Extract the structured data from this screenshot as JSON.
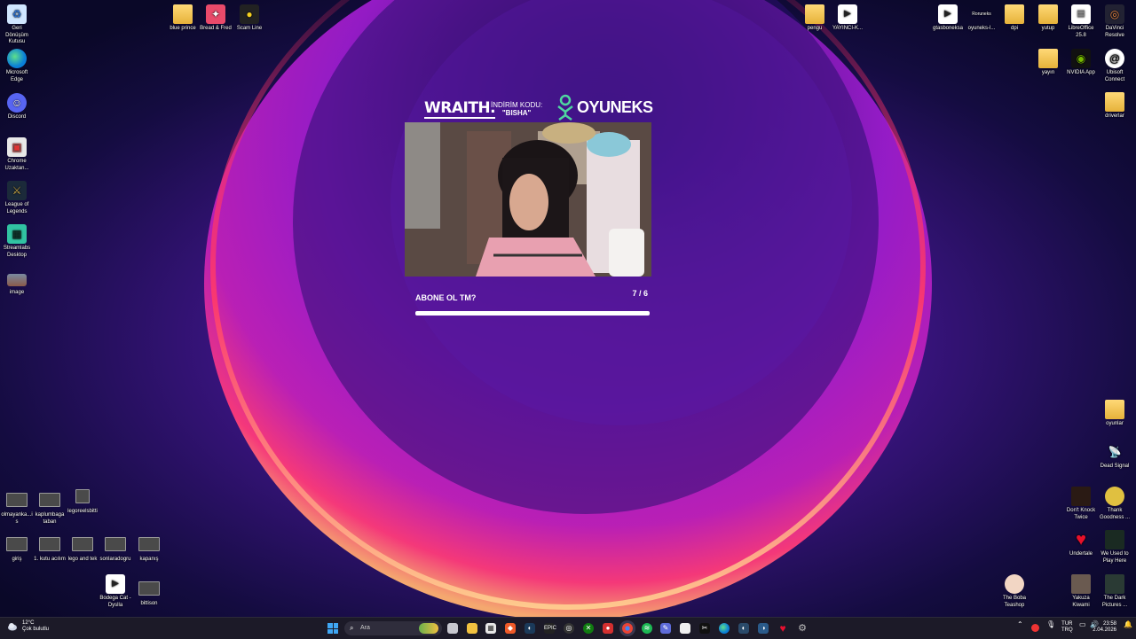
{
  "desktop": {
    "icons_left": [
      {
        "label": "Geri Dönüşüm Kutusu",
        "icon": "recycle-bin-icon"
      },
      {
        "label": "Microsoft Edge",
        "icon": "edge-icon"
      },
      {
        "label": "Discord",
        "icon": "discord-icon"
      },
      {
        "label": "Chrome Uzaktan...",
        "icon": "chrome-remote-icon"
      },
      {
        "label": "League of Legends",
        "icon": "league-icon"
      },
      {
        "label": "Streamlabs Desktop",
        "icon": "streamlabs-icon"
      },
      {
        "label": "image",
        "icon": "image-file-icon"
      }
    ],
    "icons_top": [
      {
        "label": "blue prince",
        "icon": "folder-icon"
      },
      {
        "label": "Bread & Fred",
        "icon": "game-icon"
      },
      {
        "label": "Scam Line",
        "icon": "game-icon"
      }
    ],
    "icons_top_right": [
      {
        "label": "pengu",
        "icon": "folder-icon"
      },
      {
        "label": "YAYINCI-K...",
        "icon": "media-file-icon"
      },
      {
        "label": "gtasboneksa",
        "icon": "media-file-icon"
      },
      {
        "label": "oyuneks-l...",
        "icon": "oyuneks-file-icon",
        "overline": "Roruneks"
      },
      {
        "label": "dpi",
        "icon": "folder-icon"
      },
      {
        "label": "yutup",
        "icon": "folder-icon"
      },
      {
        "label": "LibreOffice 25.8",
        "icon": "libreoffice-icon"
      },
      {
        "label": "DaVinci Resolve",
        "icon": "davinci-icon"
      },
      {
        "label": "yayın",
        "icon": "folder-icon"
      },
      {
        "label": "NVIDIA App",
        "icon": "nvidia-icon"
      },
      {
        "label": "Ubisoft Connect",
        "icon": "ubisoft-icon"
      },
      {
        "label": "driverlar",
        "icon": "folder-icon"
      }
    ],
    "icons_right": [
      {
        "label": "oyunlar",
        "icon": "folder-icon"
      },
      {
        "label": "Dead Signal",
        "icon": "game-icon"
      },
      {
        "label": "Don't Knock Twice",
        "icon": "game-icon"
      },
      {
        "label": "Thank Goodness ...",
        "icon": "game-icon"
      },
      {
        "label": "Undertale",
        "icon": "heart-icon"
      },
      {
        "label": "We Used to Play Here",
        "icon": "game-icon"
      },
      {
        "label": "The Boba Teashop",
        "icon": "game-icon"
      },
      {
        "label": "Yakuza Kiwami",
        "icon": "game-icon"
      },
      {
        "label": "The Dark Pictures ...",
        "icon": "game-icon"
      }
    ],
    "icons_bottom_left": [
      {
        "label": "olmayanka...is",
        "icon": "video-file-icon"
      },
      {
        "label": "kaplumbaga taban",
        "icon": "video-file-icon"
      },
      {
        "label": "legoreelsbitti",
        "icon": "video-file-icon"
      },
      {
        "label": "giriş",
        "icon": "video-file-icon"
      },
      {
        "label": "1. kutu acılım",
        "icon": "video-file-icon"
      },
      {
        "label": "lego and tek",
        "icon": "video-file-icon"
      },
      {
        "label": "sonlaradogru",
        "icon": "video-file-icon"
      },
      {
        "label": "kapanış",
        "icon": "video-file-icon"
      },
      {
        "label": "Bodega Cat - Dyslla",
        "icon": "media-file-icon"
      },
      {
        "label": "bittison",
        "icon": "video-file-icon"
      }
    ]
  },
  "overlay": {
    "sponsor_brand": "WRAITH.",
    "discount_label": "İNDİRİM KODU:",
    "discount_code": "\"BISHA\"",
    "partner_brand": "OYUNEKS",
    "goal_title": "ABONE OL TM?",
    "goal_count": "7 / 6",
    "goal_progress": 1.0
  },
  "taskbar": {
    "weather_temp": "12°C",
    "weather_desc": "Çok bulutlu",
    "search_placeholder": "Ara",
    "apps": [
      "file-explorer-icon",
      "calendar-icon",
      "brave-icon",
      "steam-icon",
      "epic-games-icon",
      "obs-icon",
      "xbox-icon",
      "record-icon",
      "chrome-icon",
      "spotify-icon",
      "notepad-icon",
      "capcut-icon",
      "edge-icon",
      "steam-2-icon",
      "steam-3-icon",
      "heart-app-icon",
      "settings-icon"
    ],
    "lang_top": "TUR",
    "lang_bottom": "TRQ",
    "time": "23:58",
    "date": "2.04.2026"
  },
  "colors": {
    "taskbar_bg": "#1c1a28",
    "wallpaper_base": "#0c0830",
    "accent_glow": "#ff4aa0"
  }
}
